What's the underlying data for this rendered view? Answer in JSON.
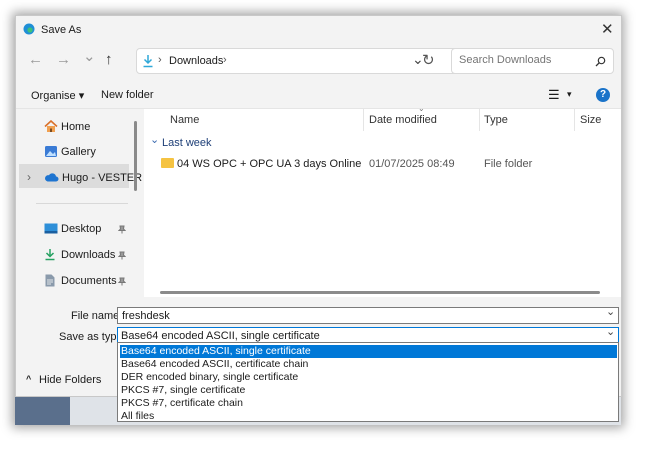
{
  "window": {
    "title": "Save As",
    "close_glyph": "✕"
  },
  "nav": {
    "back_glyph": "←",
    "forward_glyph": "→",
    "recent_glyph": "⌄",
    "up_glyph": "↑",
    "path": [
      "Downloads"
    ],
    "chevron_glyph": "›",
    "refresh_glyph": "↻",
    "search_placeholder": "Search Downloads"
  },
  "toolbar": {
    "organise_label": "Organise ▾",
    "new_folder_label": "New folder",
    "view_glyph": "☰",
    "view_caret": "▾",
    "help_glyph": "?"
  },
  "sidebar": {
    "items": [
      {
        "label": "Home",
        "icon": "home-icon"
      },
      {
        "label": "Gallery",
        "icon": "gallery-icon"
      },
      {
        "label": "Hugo - VESTER",
        "icon": "cloud-icon",
        "selected": true
      },
      {
        "label": "Desktop",
        "icon": "desktop-icon",
        "pinned": true
      },
      {
        "label": "Downloads",
        "icon": "download-icon",
        "pinned": true
      },
      {
        "label": "Documents",
        "icon": "documents-icon",
        "pinned": true
      }
    ],
    "pin_glyph": "📌",
    "expand_glyph": "›"
  },
  "columns": {
    "name": "Name",
    "date": "Date modified",
    "type": "Type",
    "size": "Size"
  },
  "groups": [
    {
      "label": "Last week",
      "toggle_glyph": "⌄",
      "rows": [
        {
          "name": "04 WS OPC + OPC UA 3 days Online",
          "date": "01/07/2025 08:49",
          "type": "File folder",
          "size": ""
        }
      ]
    }
  ],
  "form": {
    "file_name_label": "File name:",
    "file_name_value": "freshdesk",
    "save_type_label": "Save as type:",
    "save_type_value": "Base64 encoded ASCII, single certificate",
    "caret_glyph": "⌄"
  },
  "save_type_options": [
    "Base64 encoded ASCII, single certificate",
    "Base64 encoded ASCII, certificate chain",
    "DER encoded binary, single certificate",
    "PKCS #7, single certificate",
    "PKCS #7, certificate chain",
    "All files"
  ],
  "footer": {
    "hide_folders_label": "Hide Folders",
    "hide_glyph": "^"
  },
  "colors": {
    "accent": "#0078d7",
    "folder": "#f5c342",
    "dialog_bg": "#f3f3f3"
  }
}
